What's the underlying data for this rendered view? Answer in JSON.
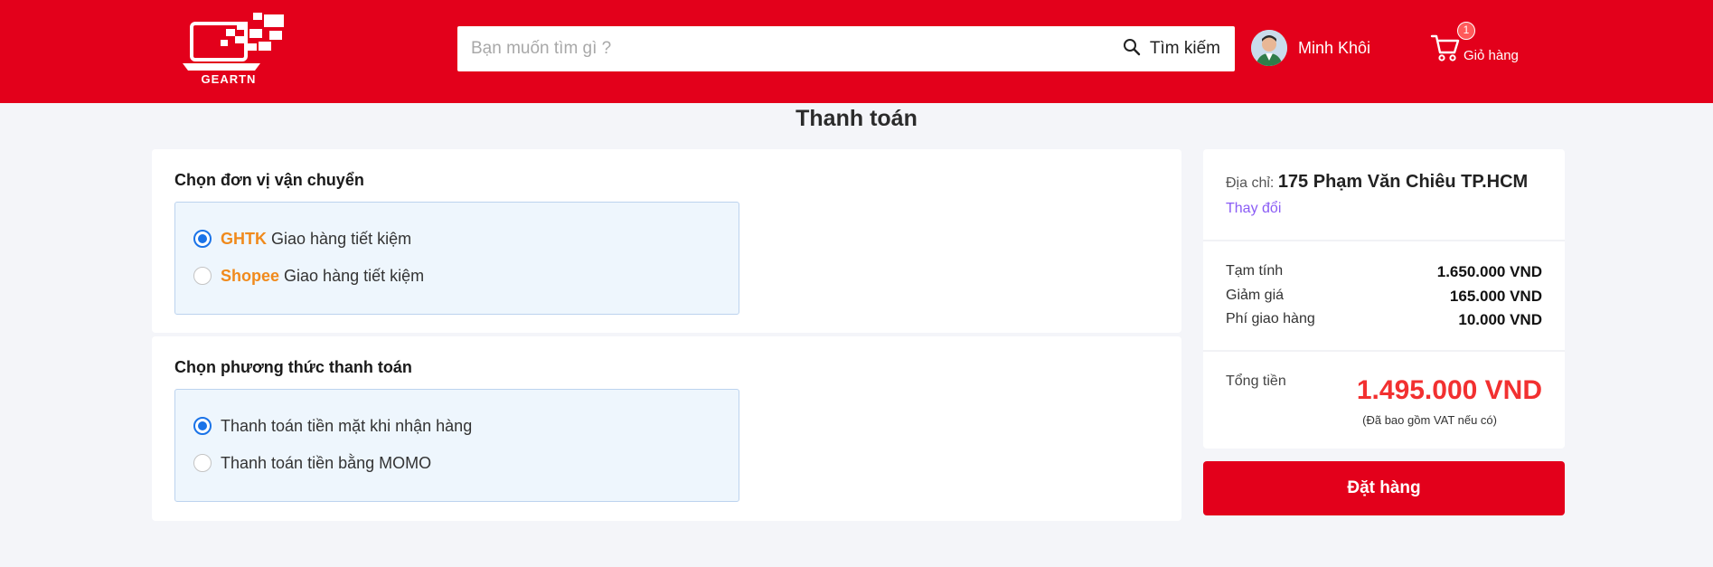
{
  "brand": {
    "logo_text": "GEARTN",
    "primary_color": "#e3001b"
  },
  "search": {
    "placeholder": "Bạn muốn tìm gì ?",
    "button_label": "Tìm kiếm"
  },
  "user": {
    "name": "Minh Khôi"
  },
  "cart": {
    "count": "1",
    "label": "Giỏ hàng"
  },
  "page_title": "Thanh toán",
  "shipping": {
    "title": "Chọn đơn vị vận chuyển",
    "options": [
      {
        "brand": "GHTK",
        "label": "Giao hàng tiết kiệm",
        "selected": true
      },
      {
        "brand": "Shopee",
        "label": "Giao hàng tiết kiệm",
        "selected": false
      }
    ]
  },
  "payment": {
    "title": "Chọn phương thức thanh toán",
    "options": [
      {
        "label": "Thanh toán tiền mặt khi nhận hàng",
        "selected": true
      },
      {
        "label": "Thanh toán tiền bằng MOMO",
        "selected": false
      }
    ]
  },
  "summary": {
    "address_label": "Địa chỉ:",
    "address": "175 Phạm Văn Chiêu TP.HCM",
    "change_label": "Thay đổi",
    "rows": [
      {
        "label": "Tạm tính",
        "value": "1.650.000 VND"
      },
      {
        "label": "Giảm giá",
        "value": "165.000 VND"
      },
      {
        "label": "Phí giao hàng",
        "value": "10.000 VND"
      }
    ],
    "total_label": "Tổng tiền",
    "total_value": "1.495.000 VND",
    "vat_note": "(Đã bao gồm VAT nếu có)",
    "order_button": "Đặt hàng"
  }
}
